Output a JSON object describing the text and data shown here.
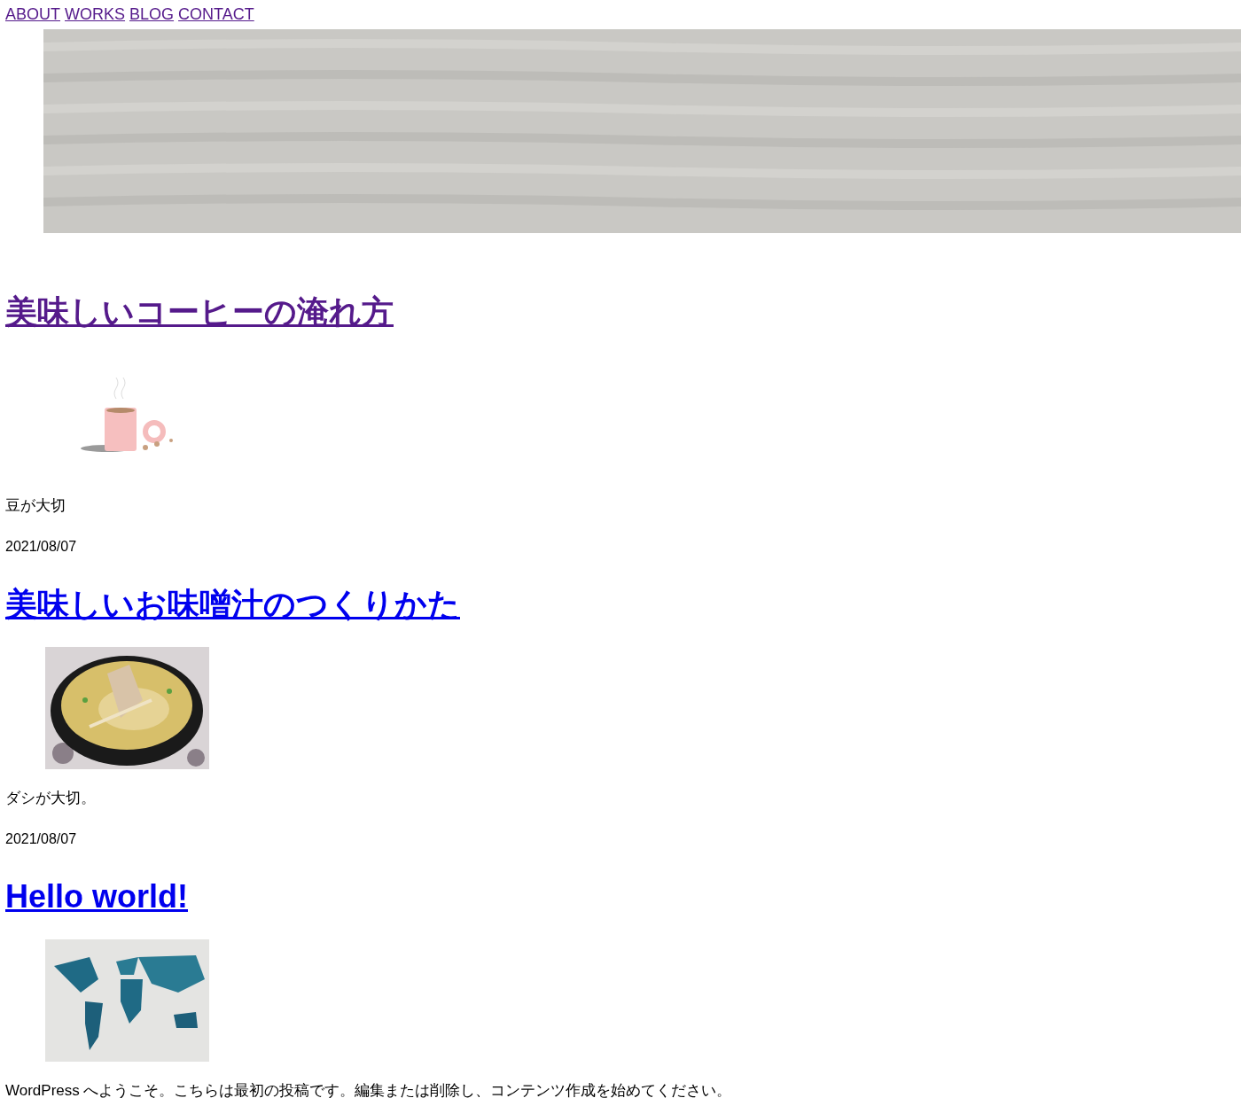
{
  "nav": [
    {
      "label": "ABOUT",
      "visited": true
    },
    {
      "label": "WORKS",
      "visited": true
    },
    {
      "label": "BLOG",
      "visited": true
    },
    {
      "label": "CONTACT",
      "visited": true
    }
  ],
  "posts": [
    {
      "title": "美味しいコーヒーの淹れ方",
      "visited": true,
      "excerpt": "豆が大切",
      "date": "2021/08/07"
    },
    {
      "title": "美味しいお味噌汁のつくりかた",
      "visited": false,
      "excerpt": "ダシが大切。",
      "date": "2021/08/07"
    },
    {
      "title": "Hello world!",
      "visited": false,
      "excerpt": "WordPress へようこそ。こちらは最初の投稿です。編集または削除し、コンテンツ作成を始めてください。"
    }
  ]
}
